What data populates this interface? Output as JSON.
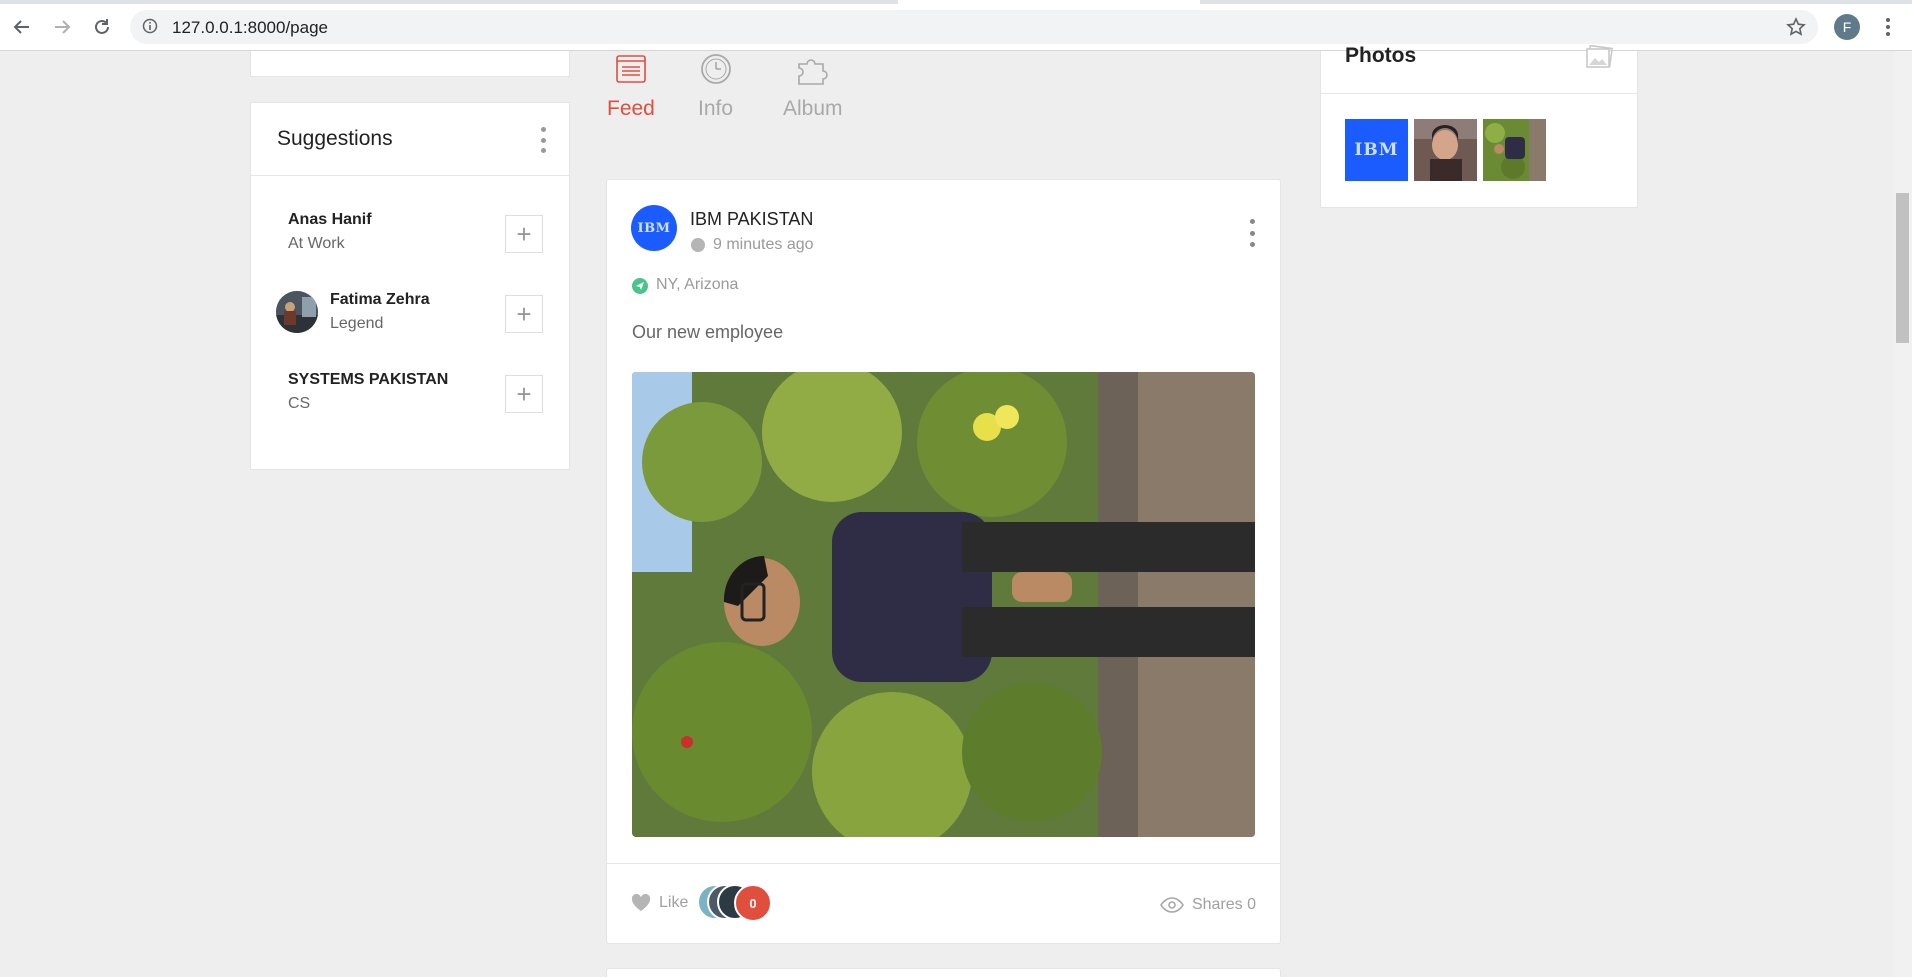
{
  "browser": {
    "url": "127.0.0.1:8000/page",
    "profile_initial": "F"
  },
  "suggestions": {
    "title": "Suggestions",
    "items": [
      {
        "name": "Anas Hanif",
        "subtitle": "At Work",
        "has_avatar": false
      },
      {
        "name": "Fatima Zehra",
        "subtitle": "Legend",
        "has_avatar": true
      },
      {
        "name": "SYSTEMS PAKISTAN",
        "subtitle": "CS",
        "has_avatar": false
      }
    ]
  },
  "tabs": [
    {
      "label": "Feed",
      "icon": "feed-icon",
      "active": true
    },
    {
      "label": "Info",
      "icon": "clock-icon",
      "active": false
    },
    {
      "label": "Album",
      "icon": "puzzle-icon",
      "active": false
    }
  ],
  "post": {
    "logo_text": "IBM",
    "author": "IBM PAKISTAN",
    "time": "9 minutes ago",
    "location": "NY, Arizona",
    "text": "Our new employee",
    "like_label": "Like",
    "like_count": "0",
    "shares_label": "Shares 0"
  },
  "photos": {
    "title": "Photos",
    "thumb_ibm_text": "IBM"
  },
  "colors": {
    "accent": "#e04e3e",
    "ibm_blue": "#1a5cff",
    "location_green": "#4cc38a"
  }
}
